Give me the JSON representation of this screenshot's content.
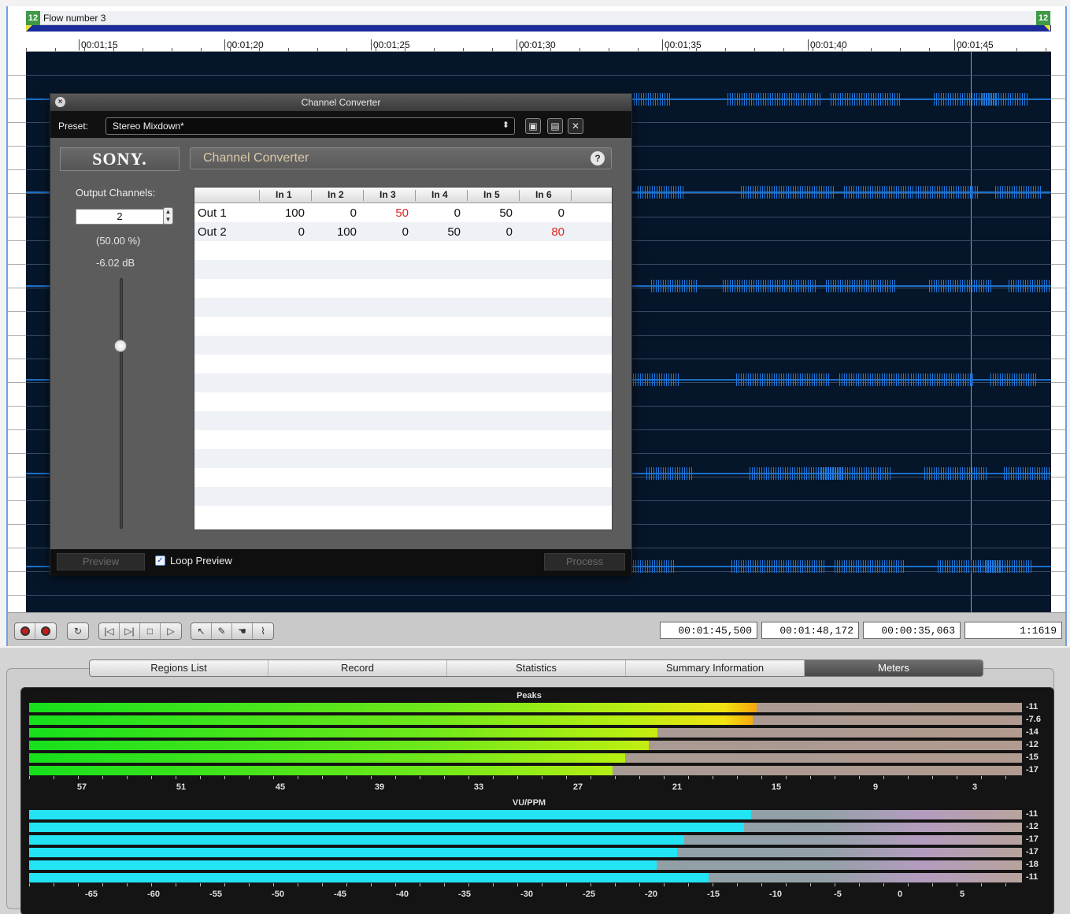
{
  "editor": {
    "region_title": "Flow number 3",
    "region_marker_left": "12",
    "region_marker_right": "12",
    "ruler_ticks": [
      "00:01;15",
      "00:01;20",
      "00:01;25",
      "00:01;30",
      "00:01;35",
      "00:01;40",
      "00:01;45"
    ]
  },
  "transport": {
    "selection_start": "00:01:45,500",
    "selection_end": "00:01:48,172",
    "selection_length": "00:00:35,063",
    "zoom": "1:1619"
  },
  "dialog": {
    "title": "Channel Converter",
    "preset_label": "Preset:",
    "preset_value": "Stereo Mixdown*",
    "brand": "SONY.",
    "plugin_name": "Channel Converter",
    "output_channels_label": "Output Channels:",
    "output_channels_value": "2",
    "gain_percent": "(50.00 %)",
    "gain_db": "-6.02 dB",
    "gain_level": 0.73,
    "matrix": {
      "columns": [
        "In 1",
        "In 2",
        "In 3",
        "In 4",
        "In 5",
        "In 6"
      ],
      "rows": [
        {
          "name": "Out 1",
          "values": [
            "100",
            "0",
            "50",
            "0",
            "50",
            "0"
          ],
          "highlight": [
            false,
            false,
            true,
            false,
            false,
            false
          ]
        },
        {
          "name": "Out 2",
          "values": [
            "0",
            "100",
            "0",
            "50",
            "0",
            "80"
          ],
          "highlight": [
            false,
            false,
            false,
            false,
            false,
            true
          ]
        }
      ],
      "highlight_color": "#e0241c"
    },
    "preview_label": "Preview",
    "loop_preview_label": "Loop Preview",
    "loop_preview_checked": true,
    "process_label": "Process"
  },
  "bottom_tabs": [
    "Regions List",
    "Record",
    "Statistics",
    "Summary Information",
    "Meters"
  ],
  "active_tab": "Meters",
  "meters": {
    "peaks": {
      "title": "Peaks",
      "values": [
        "-11",
        "-7.6",
        "-14",
        "-12",
        "-15",
        "-17"
      ],
      "levels": [
        0.733,
        0.729,
        0.633,
        0.624,
        0.6,
        0.588
      ],
      "scale": [
        "57",
        "51",
        "45",
        "39",
        "33",
        "27",
        "21",
        "15",
        "9",
        "3"
      ]
    },
    "vu": {
      "title": "VU/PPM",
      "values": [
        "-11",
        "-12",
        "-17",
        "-17",
        "-18",
        "-11"
      ],
      "levels": [
        0.727,
        0.72,
        0.66,
        0.653,
        0.632,
        0.684
      ],
      "scale": [
        "-65",
        "-60",
        "-55",
        "-50",
        "-45",
        "-40",
        "-35",
        "-30",
        "-25",
        "-20",
        "-15",
        "-10",
        "-5",
        "0",
        "5"
      ]
    }
  }
}
